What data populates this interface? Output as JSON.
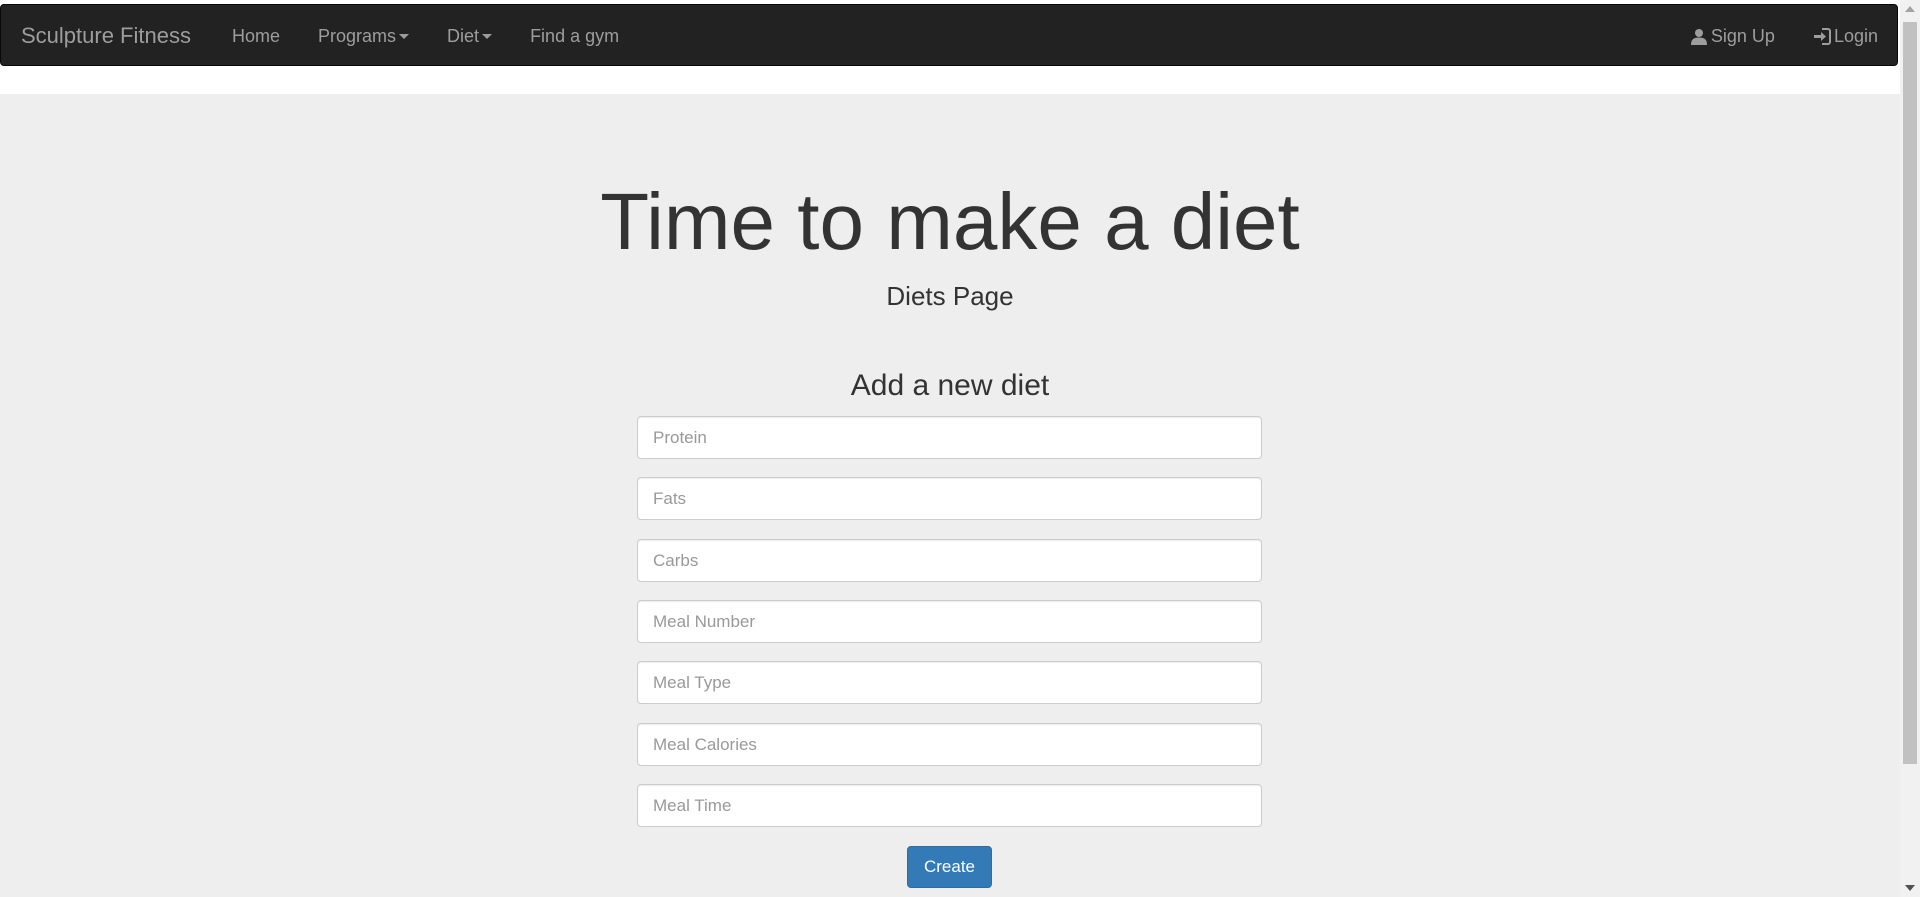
{
  "navbar": {
    "brand": "Sculpture Fitness",
    "items": [
      {
        "label": "Home",
        "dropdown": false
      },
      {
        "label": "Programs",
        "dropdown": true
      },
      {
        "label": "Diet",
        "dropdown": true
      },
      {
        "label": "Find a gym",
        "dropdown": false
      }
    ],
    "right_items": [
      {
        "label": "Sign Up",
        "icon": "user-icon"
      },
      {
        "label": "Login",
        "icon": "log-in-icon"
      }
    ]
  },
  "main": {
    "headline": "Time to make a diet",
    "subheading": "Diets Page",
    "form": {
      "title": "Add a new diet",
      "fields": [
        {
          "placeholder": "Protein",
          "value": ""
        },
        {
          "placeholder": "Fats",
          "value": ""
        },
        {
          "placeholder": "Carbs",
          "value": ""
        },
        {
          "placeholder": "Meal Number",
          "value": ""
        },
        {
          "placeholder": "Meal Type",
          "value": ""
        },
        {
          "placeholder": "Meal Calories",
          "value": ""
        },
        {
          "placeholder": "Meal Time",
          "value": ""
        }
      ],
      "submit_label": "Create"
    }
  },
  "colors": {
    "navbar_bg": "#222222",
    "nav_text": "#9d9d9d",
    "jumbotron_bg": "#eeeeee",
    "primary_button": "#337ab7"
  }
}
